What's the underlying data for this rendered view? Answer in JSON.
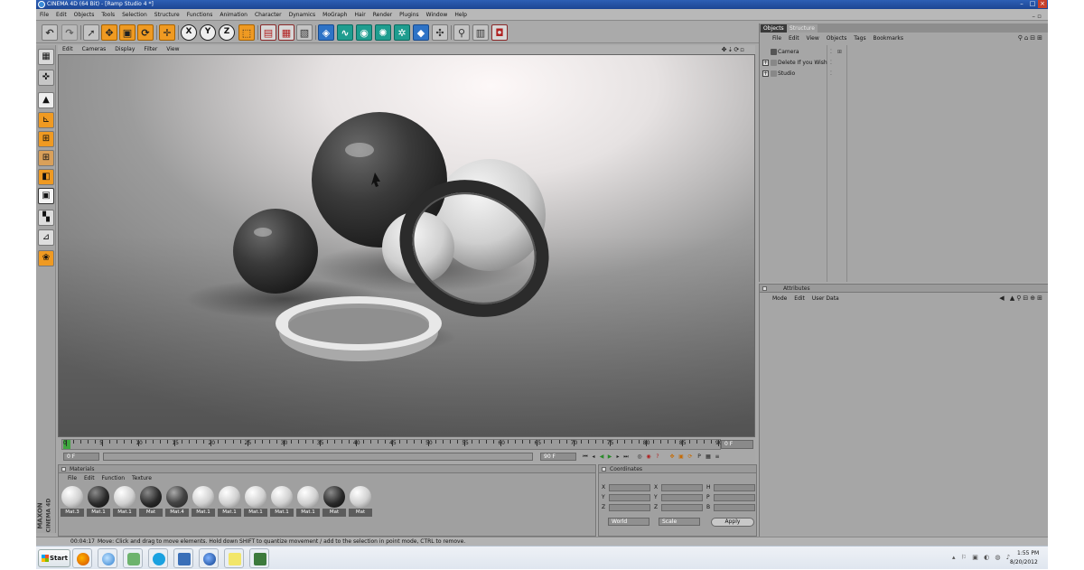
{
  "window": {
    "title": "CINEMA 4D (64 Bit) - [Ramp Studio 4 *]"
  },
  "menubar": [
    "File",
    "Edit",
    "Objects",
    "Tools",
    "Selection",
    "Structure",
    "Functions",
    "Animation",
    "Character",
    "Dynamics",
    "MoGraph",
    "Hair",
    "Render",
    "Plugins",
    "Window",
    "Help"
  ],
  "toolbar": {
    "axis_x": "X",
    "axis_y": "Y",
    "axis_z": "Z"
  },
  "viewport": {
    "menu": [
      "Edit",
      "Cameras",
      "Display",
      "Filter",
      "View"
    ]
  },
  "timeline": {
    "ticks": [
      "0",
      "5",
      "10",
      "15",
      "20",
      "25",
      "30",
      "35",
      "40",
      "45",
      "50",
      "55",
      "60",
      "65",
      "70",
      "75",
      "80",
      "85",
      "90"
    ],
    "current_frame": "0 F",
    "start_field": "0 F",
    "end_field": "90 F",
    "range_end": "0 F"
  },
  "materials": {
    "panel_title": "Materials",
    "menu": [
      "File",
      "Edit",
      "Function",
      "Texture"
    ],
    "items": [
      {
        "label": "Mat.3"
      },
      {
        "label": "Mat.1"
      },
      {
        "label": "Mat.1"
      },
      {
        "label": "Mat"
      },
      {
        "label": "Mat.4"
      },
      {
        "label": "Mat.1"
      },
      {
        "label": "Mat.1"
      },
      {
        "label": "Mat.1"
      },
      {
        "label": "Mat.1"
      },
      {
        "label": "Mat.1"
      },
      {
        "label": "Mat"
      },
      {
        "label": "Mat"
      }
    ]
  },
  "coordinates": {
    "panel_title": "Coordinates",
    "col1": [
      "X",
      "Y",
      "Z"
    ],
    "col2": [
      "X",
      "Y",
      "Z"
    ],
    "col3": [
      "H",
      "P",
      "B"
    ],
    "mode1": "World",
    "mode2": "Scale",
    "apply": "Apply"
  },
  "objects": {
    "tab_active": "Objects",
    "tab_inactive": "Structure",
    "menu": [
      "File",
      "Edit",
      "View",
      "Objects",
      "Tags",
      "Bookmarks"
    ],
    "items": [
      {
        "name": "Camera"
      },
      {
        "name": "Delete If you Wish"
      },
      {
        "name": "Studio"
      }
    ]
  },
  "attributes": {
    "panel_title": "Attributes",
    "menu": [
      "Mode",
      "Edit",
      "User Data"
    ]
  },
  "status": {
    "time": "00:04:17",
    "message": "Move: Click and drag to move elements. Hold down SHIFT to quantize movement / add to the selection in point mode, CTRL to remove."
  },
  "maxon": {
    "brand": "MAXON",
    "product": "CINEMA 4D"
  },
  "taskbar": {
    "start": "Start",
    "clock_time": "1:55 PM",
    "clock_date": "8/20/2012"
  }
}
